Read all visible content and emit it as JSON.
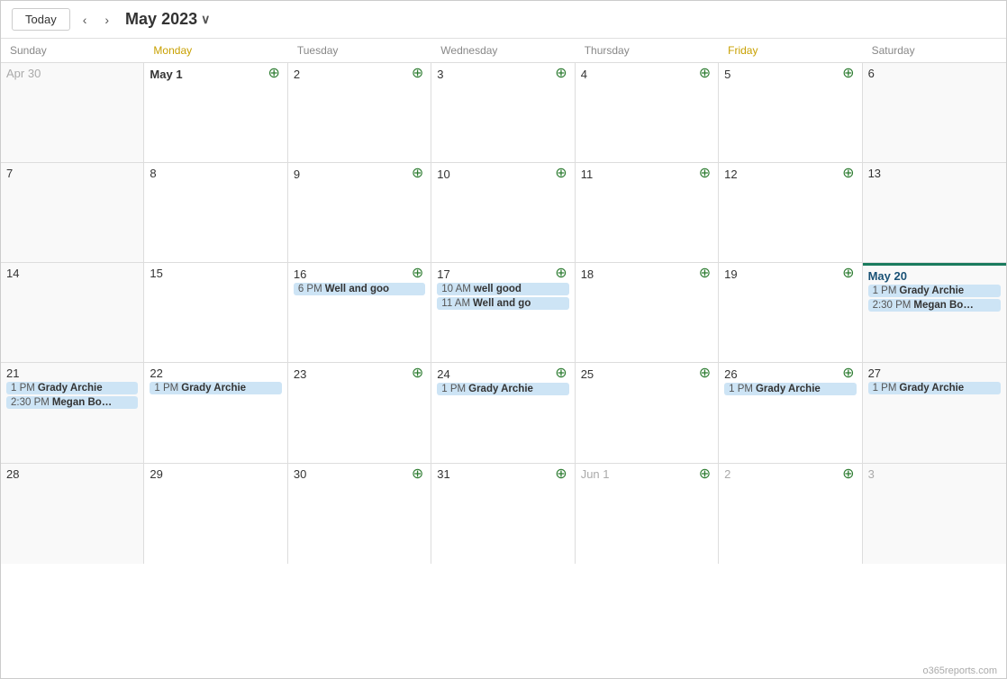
{
  "toolbar": {
    "today_label": "Today",
    "prev_label": "‹",
    "next_label": "›",
    "month_title": "May 2023",
    "chevron": "∨"
  },
  "day_headers": [
    {
      "label": "Sunday",
      "class": ""
    },
    {
      "label": "Monday",
      "class": "monday"
    },
    {
      "label": "Tuesday",
      "class": ""
    },
    {
      "label": "Wednesday",
      "class": ""
    },
    {
      "label": "Thursday",
      "class": ""
    },
    {
      "label": "Friday",
      "class": "friday"
    },
    {
      "label": "Saturday",
      "class": ""
    }
  ],
  "weeks": [
    {
      "days": [
        {
          "num": "Apr 30",
          "has_add": false,
          "other": true,
          "events": []
        },
        {
          "num": "May 1",
          "has_add": true,
          "bold": true,
          "events": []
        },
        {
          "num": "2",
          "has_add": true,
          "events": []
        },
        {
          "num": "3",
          "has_add": true,
          "events": []
        },
        {
          "num": "4",
          "has_add": true,
          "events": []
        },
        {
          "num": "5",
          "has_add": true,
          "events": []
        },
        {
          "num": "6",
          "has_add": false,
          "events": []
        }
      ]
    },
    {
      "days": [
        {
          "num": "7",
          "has_add": false,
          "events": []
        },
        {
          "num": "8",
          "has_add": false,
          "events": []
        },
        {
          "num": "9",
          "has_add": true,
          "events": []
        },
        {
          "num": "10",
          "has_add": true,
          "events": []
        },
        {
          "num": "11",
          "has_add": true,
          "events": []
        },
        {
          "num": "12",
          "has_add": true,
          "events": []
        },
        {
          "num": "13",
          "has_add": false,
          "events": []
        }
      ]
    },
    {
      "days": [
        {
          "num": "14",
          "has_add": false,
          "events": []
        },
        {
          "num": "15",
          "has_add": false,
          "events": []
        },
        {
          "num": "16",
          "has_add": true,
          "events": [
            {
              "time": "6 PM",
              "title": "Well and goo"
            }
          ]
        },
        {
          "num": "17",
          "has_add": true,
          "events": [
            {
              "time": "10 AM",
              "title": "well good"
            },
            {
              "time": "11 AM",
              "title": "Well and go"
            }
          ]
        },
        {
          "num": "18",
          "has_add": true,
          "events": []
        },
        {
          "num": "19",
          "has_add": true,
          "events": []
        },
        {
          "num": "May 20",
          "has_add": false,
          "today": true,
          "events": [
            {
              "time": "1 PM",
              "title": "Grady Archie"
            },
            {
              "time": "2:30 PM",
              "title": "Megan Bo…"
            }
          ]
        }
      ]
    },
    {
      "days": [
        {
          "num": "21",
          "has_add": false,
          "events": [
            {
              "time": "1 PM",
              "title": "Grady Archie"
            },
            {
              "time": "2:30 PM",
              "title": "Megan Bo…"
            }
          ]
        },
        {
          "num": "22",
          "has_add": false,
          "events": [
            {
              "time": "1 PM",
              "title": "Grady Archie"
            }
          ]
        },
        {
          "num": "23",
          "has_add": true,
          "events": []
        },
        {
          "num": "24",
          "has_add": true,
          "events": [
            {
              "time": "1 PM",
              "title": "Grady Archie"
            }
          ]
        },
        {
          "num": "25",
          "has_add": true,
          "events": []
        },
        {
          "num": "26",
          "has_add": true,
          "events": [
            {
              "time": "1 PM",
              "title": "Grady Archie"
            }
          ]
        },
        {
          "num": "27",
          "has_add": false,
          "events": [
            {
              "time": "1 PM",
              "title": "Grady Archie"
            }
          ]
        }
      ]
    },
    {
      "days": [
        {
          "num": "28",
          "has_add": false,
          "events": []
        },
        {
          "num": "29",
          "has_add": false,
          "events": []
        },
        {
          "num": "30",
          "has_add": true,
          "events": []
        },
        {
          "num": "31",
          "has_add": true,
          "events": []
        },
        {
          "num": "Jun 1",
          "has_add": true,
          "other": true,
          "events": []
        },
        {
          "num": "2",
          "has_add": true,
          "other": true,
          "events": []
        },
        {
          "num": "3",
          "has_add": false,
          "other": true,
          "events": []
        }
      ]
    }
  ],
  "watermark": "o365reports.com"
}
